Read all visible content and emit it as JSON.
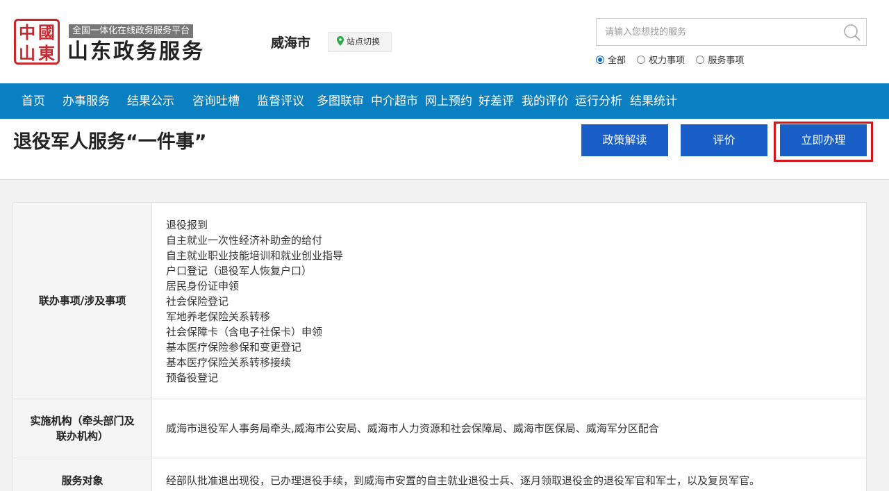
{
  "header": {
    "logo_seal": [
      "中",
      "國",
      "山",
      "東"
    ],
    "logo_subtitle": "全国一体化在线政务服务平台",
    "logo_title": "山东政务服务",
    "city": "威海市",
    "site_switch": "站点切换",
    "search": {
      "placeholder": "请输入您想找的服务"
    },
    "filters": [
      "全部",
      "权力事项",
      "服务事项"
    ],
    "filter_selected": "全部"
  },
  "nav": {
    "items": [
      "首页",
      "办事服务",
      "结果公示",
      "咨询吐槽",
      "监督评议",
      "多图联审",
      "中介超市",
      "网上预约",
      "好差评",
      "我的评价",
      "运行分析",
      "结果统计"
    ]
  },
  "page": {
    "title": "退役军人服务“一件事”",
    "buttons": {
      "policy": "政策解读",
      "evaluate": "评价",
      "apply": "立即办理"
    }
  },
  "table": {
    "rows": [
      {
        "label": "联办事项/涉及事项",
        "items": [
          "退役报到",
          "自主就业一次性经济补助金的给付",
          "自主就业职业技能培训和就业创业指导",
          "户口登记（退役军人恢复户口）",
          "居民身份证申领",
          "社会保险登记",
          "军地养老保险关系转移",
          "社会保障卡（含电子社保卡）申领",
          "基本医疗保险参保和变更登记",
          "基本医疗保险关系转移接续",
          "预备役登记"
        ]
      },
      {
        "label": "实施机构（牵头部门及联办机构）",
        "value": "威海市退役军人事务局牵头,威海市公安局、威海市人力资源和社会保障局、威海市医保局、威海军分区配合"
      },
      {
        "label": "服务对象",
        "value": "经部队批准退出现役，已办理退役手续，到威海市安置的自主就业退役士兵、逐月领取退役金的退役军官和军士，以及复员军官。"
      }
    ]
  },
  "colors": {
    "nav_bg": "#0a7fc2",
    "button_bg": "#1a5fc7",
    "highlight": "#d4151c",
    "seal": "#c7282e"
  }
}
